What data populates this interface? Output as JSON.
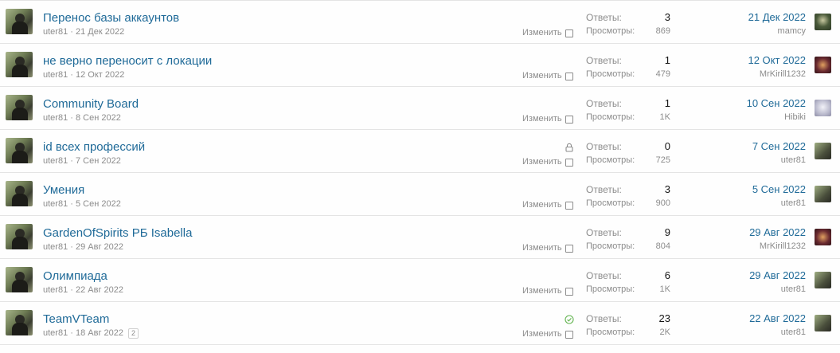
{
  "labels": {
    "answers": "Ответы:",
    "views": "Просмотры:",
    "edit": "Изменить"
  },
  "threads": [
    {
      "title": "Перенос базы аккаунтов",
      "author": "uter81",
      "date": "21 Дек 2022",
      "answers": "3",
      "views": "869",
      "last_date": "21 Дек 2022",
      "last_user": "mamcy",
      "last_avatar": "mamcy",
      "status_icon": "",
      "page_badge": ""
    },
    {
      "title": "не верно переносит с локации",
      "author": "uter81",
      "date": "12 Окт 2022",
      "answers": "1",
      "views": "479",
      "last_date": "12 Окт 2022",
      "last_user": "MrKirill1232",
      "last_avatar": "mrkirill",
      "status_icon": "",
      "page_badge": ""
    },
    {
      "title": "Community Board",
      "author": "uter81",
      "date": "8 Сен 2022",
      "answers": "1",
      "views": "1K",
      "last_date": "10 Сен 2022",
      "last_user": "Hibiki",
      "last_avatar": "hibiki",
      "status_icon": "",
      "page_badge": ""
    },
    {
      "title": "id всех профессий",
      "author": "uter81",
      "date": "7 Сен 2022",
      "answers": "0",
      "views": "725",
      "last_date": "7 Сен 2022",
      "last_user": "uter81",
      "last_avatar": "uter81",
      "status_icon": "lock-icon",
      "page_badge": ""
    },
    {
      "title": "Умения",
      "author": "uter81",
      "date": "5 Сен 2022",
      "answers": "3",
      "views": "900",
      "last_date": "5 Сен 2022",
      "last_user": "uter81",
      "last_avatar": "uter81",
      "status_icon": "",
      "page_badge": ""
    },
    {
      "title": "GardenOfSpirits РБ Isabella",
      "author": "uter81",
      "date": "29 Авг 2022",
      "answers": "9",
      "views": "804",
      "last_date": "29 Авг 2022",
      "last_user": "MrKirill1232",
      "last_avatar": "mrkirill",
      "status_icon": "",
      "page_badge": ""
    },
    {
      "title": "Олимпиада",
      "author": "uter81",
      "date": "22 Авг 2022",
      "answers": "6",
      "views": "1K",
      "last_date": "29 Авг 2022",
      "last_user": "uter81",
      "last_avatar": "uter81",
      "status_icon": "",
      "page_badge": ""
    },
    {
      "title": "TeamVTeam",
      "author": "uter81",
      "date": "18 Авг 2022",
      "answers": "23",
      "views": "2K",
      "last_date": "22 Авг 2022",
      "last_user": "uter81",
      "last_avatar": "uter81",
      "status_icon": "solved-check-icon",
      "page_badge": "2"
    }
  ],
  "colors": {
    "link": "#1f6a98",
    "muted": "#8c8c8c",
    "solved": "#63b450"
  }
}
